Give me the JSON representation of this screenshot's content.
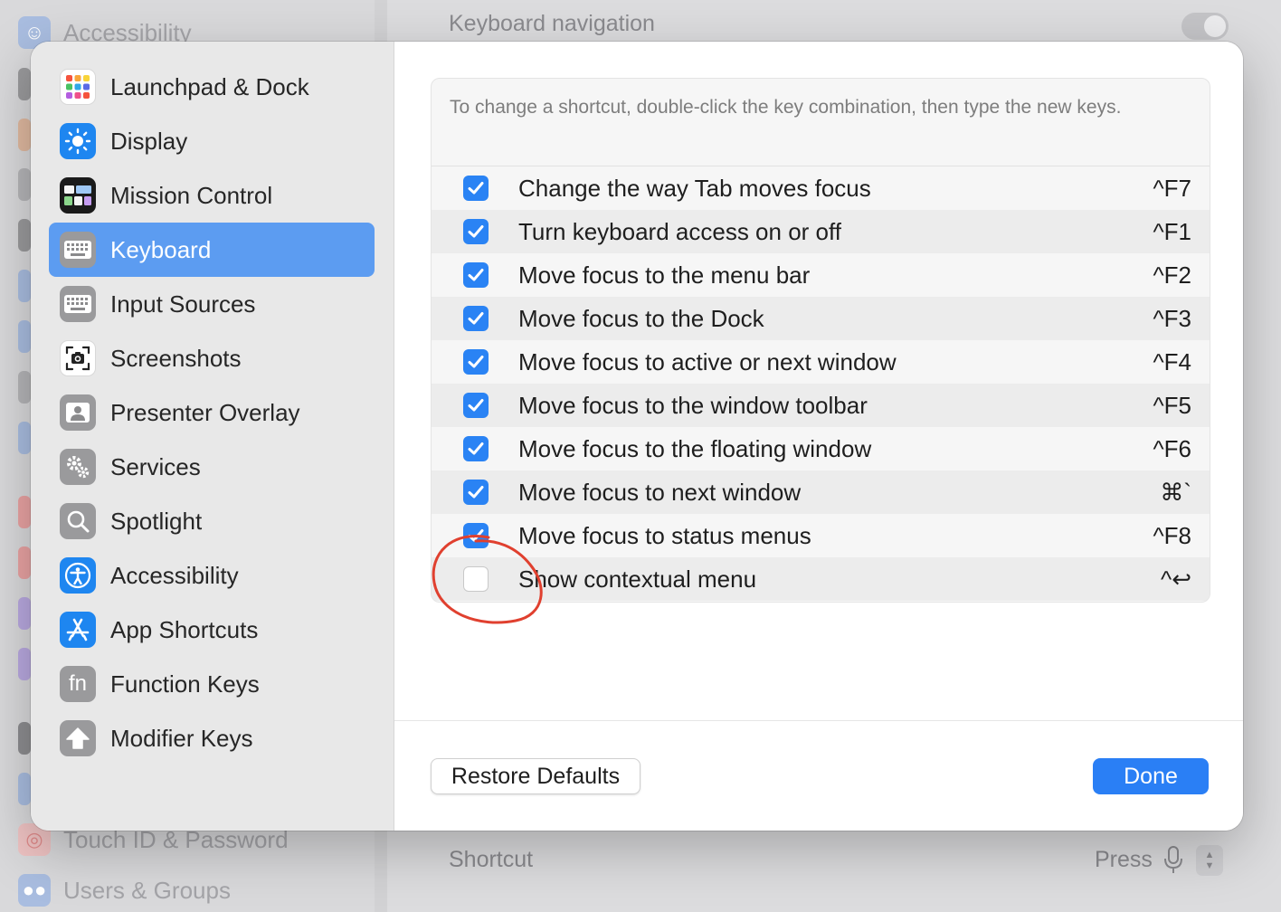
{
  "background": {
    "sidebar_items": [
      {
        "label": "Accessibility",
        "icon": "accessibility-icon",
        "color": "#6e9ee6"
      },
      {
        "label": "Touch ID & Password",
        "icon": "fingerprint-icon",
        "color": "#e56a6a"
      },
      {
        "label": "Users & Groups",
        "icon": "users-icon",
        "color": "#6e9ee6"
      }
    ],
    "keyboard_navigation_label": "Keyboard navigation",
    "shortcut_label": "Shortcut",
    "shortcut_value": "Press"
  },
  "sidebar": {
    "items": [
      {
        "label": "Launchpad & Dock",
        "icon": "launchpad-icon"
      },
      {
        "label": "Display",
        "icon": "display-icon"
      },
      {
        "label": "Mission Control",
        "icon": "mission-control-icon"
      },
      {
        "label": "Keyboard",
        "icon": "keyboard-icon",
        "selected": true
      },
      {
        "label": "Input Sources",
        "icon": "input-sources-icon"
      },
      {
        "label": "Screenshots",
        "icon": "screenshots-icon"
      },
      {
        "label": "Presenter Overlay",
        "icon": "presenter-overlay-icon"
      },
      {
        "label": "Services",
        "icon": "services-icon"
      },
      {
        "label": "Spotlight",
        "icon": "spotlight-icon"
      },
      {
        "label": "Accessibility",
        "icon": "accessibility-icon"
      },
      {
        "label": "App Shortcuts",
        "icon": "app-shortcuts-icon"
      },
      {
        "label": "Function Keys",
        "icon": "function-keys-icon",
        "glyph": "fn"
      },
      {
        "label": "Modifier Keys",
        "icon": "modifier-keys-icon"
      }
    ]
  },
  "main": {
    "instructions": "To change a shortcut, double-click the key combination, then type the new keys.",
    "shortcuts": [
      {
        "label": "Change the way Tab moves focus",
        "key": "^F7",
        "checked": true
      },
      {
        "label": "Turn keyboard access on or off",
        "key": "^F1",
        "checked": true
      },
      {
        "label": "Move focus to the menu bar",
        "key": "^F2",
        "checked": true
      },
      {
        "label": "Move focus to the Dock",
        "key": "^F3",
        "checked": true
      },
      {
        "label": "Move focus to active or next window",
        "key": "^F4",
        "checked": true
      },
      {
        "label": "Move focus to the window toolbar",
        "key": "^F5",
        "checked": true
      },
      {
        "label": "Move focus to the floating window",
        "key": "^F6",
        "checked": true
      },
      {
        "label": "Move focus to next window",
        "key": "⌘`",
        "checked": true
      },
      {
        "label": "Move focus to status menus",
        "key": "^F8",
        "checked": true
      },
      {
        "label": "Show contextual menu",
        "key": "^↩",
        "checked": false
      }
    ],
    "restore_label": "Restore Defaults",
    "done_label": "Done"
  },
  "colors": {
    "accent": "#2a83f4",
    "selection": "#5c9cf1",
    "annotation": "#e0402f"
  }
}
